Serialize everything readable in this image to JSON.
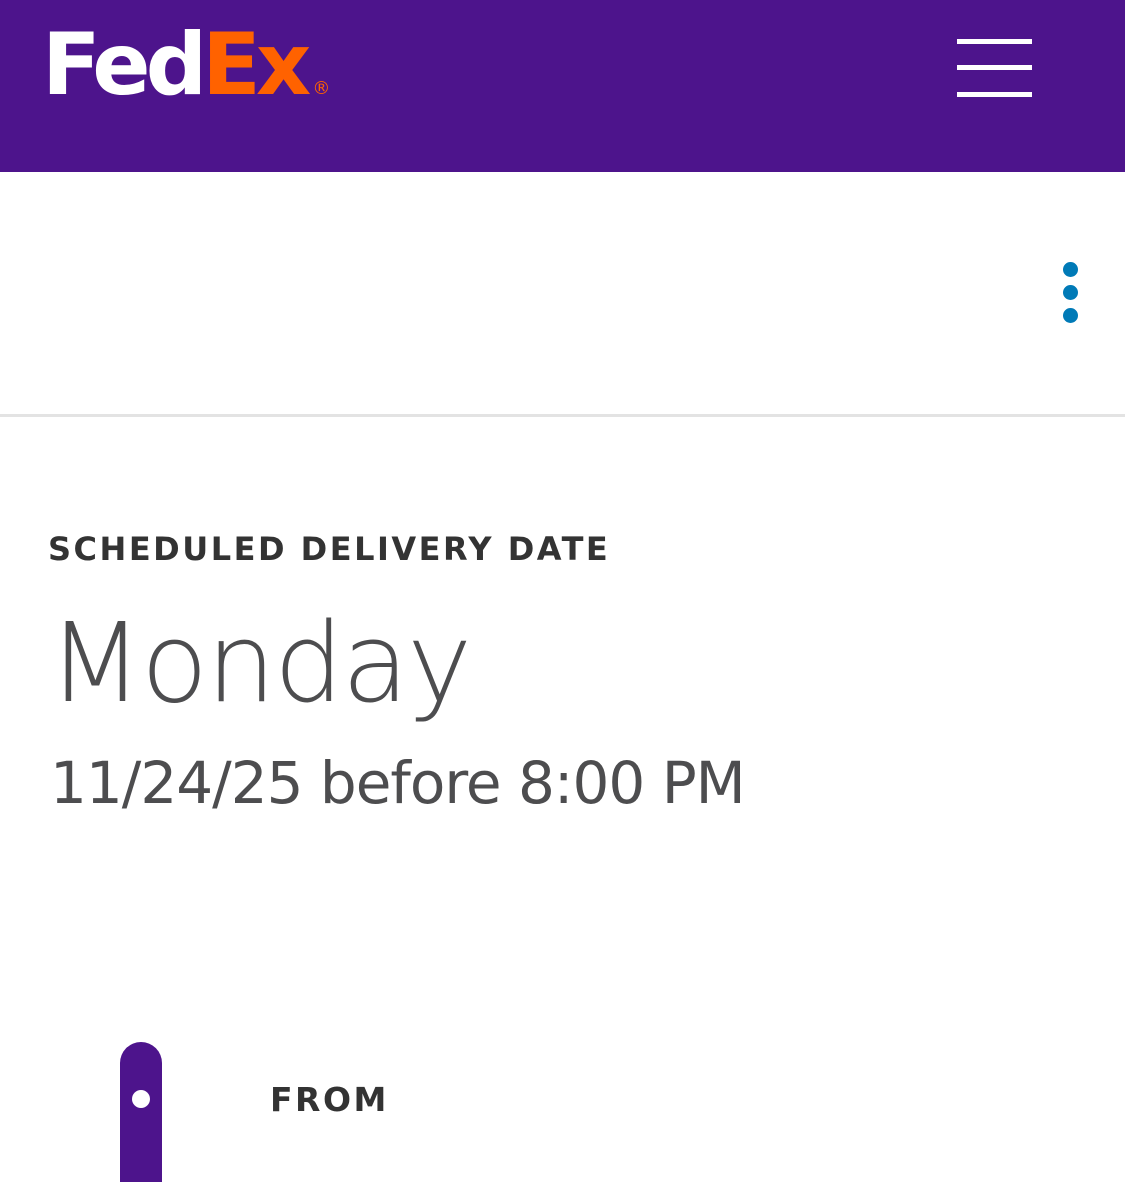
{
  "header": {
    "logo": {
      "fed": "Fed",
      "ex": "Ex",
      "registered_mark": "®",
      "colors": {
        "fed": "#ffffff",
        "ex": "#ff6200"
      }
    },
    "menu_icon": "hamburger-menu-icon",
    "background_color": "#4d148c"
  },
  "toolbar": {
    "more_options_icon": "vertical-ellipsis-icon",
    "accent_color": "#007ab7"
  },
  "delivery": {
    "label": "SCHEDULED DELIVERY DATE",
    "day": "Monday",
    "date_time": "11/24/25 before 8:00 PM"
  },
  "route": {
    "from_label": "FROM",
    "marker_icon": "origin-dot-icon"
  }
}
